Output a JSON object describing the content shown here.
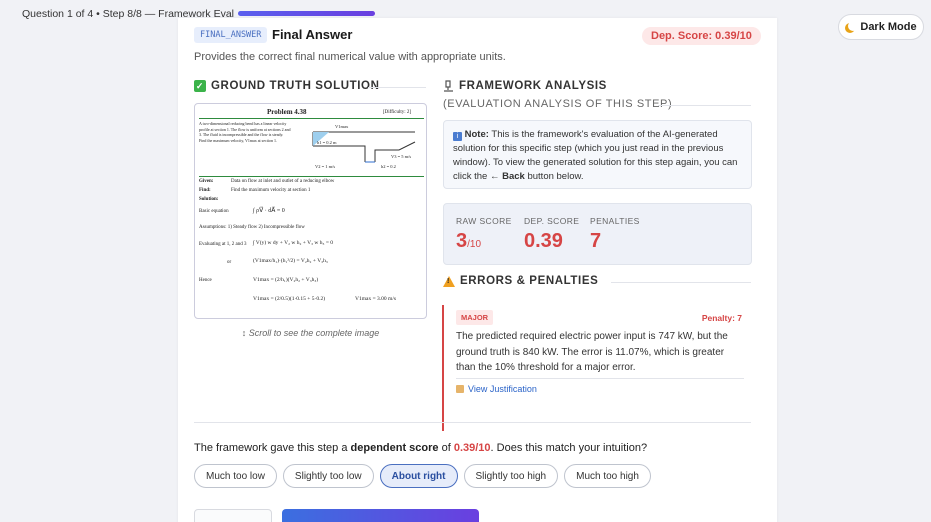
{
  "header": {
    "progress_text": "Question 1 of 4 • Step 8/8 — Framework Eval",
    "progress_fraction": 0.45,
    "dark_mode_label": "Dark Mode"
  },
  "step": {
    "tag": "FINAL_ANSWER",
    "title": "Final Answer",
    "dep_score_badge": "Dep. Score: 0.39/10",
    "description": "Provides the correct final numerical value with appropriate units."
  },
  "ground_truth": {
    "heading": "GROUND TRUTH SOLUTION",
    "scroll_hint": "↕ Scroll to see the complete image",
    "doc": {
      "problem": "Problem 4.38",
      "difficulty": "[Difficulty: 2]",
      "given_label": "Given:",
      "given_text": "Data on flow at inlet and outlet of a reducing elbow",
      "find_label": "Find:",
      "find_text": "Find the maximum velocity at section 1",
      "solution_label": "Solution:",
      "basic_eq": "Basic equation",
      "assumptions": "Assumptions: 1) Steady flow  2) Incompressible flow",
      "evaluating": "Evaluating at 1, 2 and 3",
      "or": "or",
      "hence": "Hence",
      "result": "V1max = 3.00 m/s"
    }
  },
  "framework": {
    "heading": "FRAMEWORK ANALYSIS",
    "subheading": "(EVALUATION ANALYSIS OF THIS STEP)",
    "note_label": "Note:",
    "note_text": " This is the framework's evaluation of the AI-generated solution for this specific step (which you just read in the previous window). To view the generated solution for this step again, you can click the ← ",
    "note_back": "Back",
    "note_tail": " button below.",
    "scores": {
      "raw_label": "RAW SCORE",
      "raw_value": "3",
      "raw_of": "/10",
      "dep_label": "DEP. SCORE",
      "dep_value": "0.39",
      "pen_label": "PENALTIES",
      "pen_value": "7"
    }
  },
  "errors": {
    "heading": "ERRORS & PENALTIES",
    "items": [
      {
        "severity": "MAJOR",
        "penalty": "Penalty: 7",
        "text": "The predicted required electric power input is 747 kW, but the ground truth is 840 kW. The error is 11.07%, which is greater than the 10% threshold for a major error.",
        "justification_link": "View Justification"
      }
    ]
  },
  "rating": {
    "question_prefix": "The framework gave this step a ",
    "question_bold": "dependent score",
    "question_mid": " of ",
    "question_score": "0.39/10",
    "question_suffix": ". Does this match your intuition?",
    "options": [
      "Much too low",
      "Slightly too low",
      "About right",
      "Slightly too high",
      "Much too high"
    ],
    "selected": "About right"
  },
  "colors": {
    "accent": "#4a6fc0",
    "danger": "#d64545",
    "success": "#3bb34a",
    "warning": "#f0a020"
  }
}
